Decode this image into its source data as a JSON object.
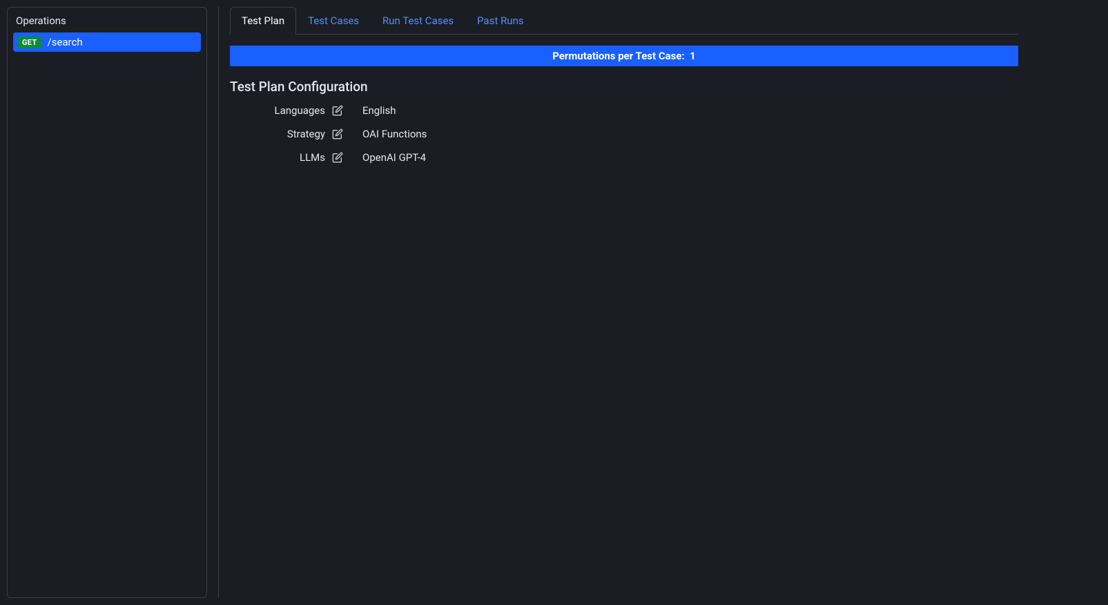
{
  "sidebar": {
    "title": "Operations",
    "operations": [
      {
        "method": "GET",
        "path": "/search"
      }
    ]
  },
  "tabs": [
    {
      "label": "Test Plan",
      "active": true
    },
    {
      "label": "Test Cases",
      "active": false
    },
    {
      "label": "Run Test Cases",
      "active": false
    },
    {
      "label": "Past Runs",
      "active": false
    }
  ],
  "permutations": {
    "label": "Permutations per Test Case:",
    "value": "1"
  },
  "config": {
    "title": "Test Plan Configuration",
    "rows": [
      {
        "label": "Languages",
        "value": "English"
      },
      {
        "label": "Strategy",
        "value": "OAI Functions"
      },
      {
        "label": "LLMs",
        "value": "OpenAI GPT-4"
      }
    ]
  }
}
